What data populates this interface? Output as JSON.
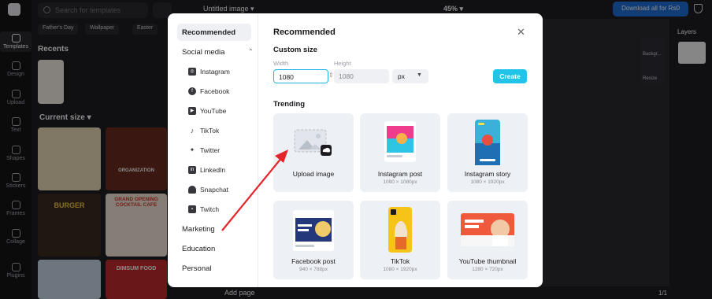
{
  "app": {
    "search_placeholder": "Search for templates",
    "chips": [
      "Father's Day",
      "Wallpaper",
      "Easter"
    ],
    "recents_title": "Recents",
    "current_size_label": "Current size",
    "rail_items": [
      "Templates",
      "Design",
      "Upload",
      "Text",
      "Shapes",
      "Stickers",
      "Frames",
      "Collage",
      "Plugins"
    ],
    "file_title": "Untitled image",
    "zoom": "45%",
    "download_label": "Download all for Rs0",
    "layers_title": "Layers",
    "side_tools": [
      "Backgr...",
      "Resize"
    ],
    "add_page_label": "Add page",
    "page_count": "1/1",
    "template_texts": [
      "GRAND OPENING COCKTAIL CAFE",
      "BURGER",
      "DIMSUM FOOD",
      "ORGANIZATION"
    ]
  },
  "modal": {
    "nav": {
      "recommended": "Recommended",
      "social_media": "Social media",
      "social_items": [
        {
          "label": "Instagram",
          "icon": "instagram-icon"
        },
        {
          "label": "Facebook",
          "icon": "facebook-icon"
        },
        {
          "label": "YouTube",
          "icon": "youtube-icon"
        },
        {
          "label": "TikTok",
          "icon": "tiktok-icon"
        },
        {
          "label": "Twitter",
          "icon": "twitter-icon"
        },
        {
          "label": "LinkedIn",
          "icon": "linkedin-icon"
        },
        {
          "label": "Snapchat",
          "icon": "snapchat-icon"
        },
        {
          "label": "Twitch",
          "icon": "twitch-icon"
        }
      ],
      "marketing": "Marketing",
      "education": "Education",
      "personal": "Personal"
    },
    "title": "Recommended",
    "custom_size_title": "Custom size",
    "width_label": "Width",
    "height_label": "Height",
    "width_value": "1080",
    "height_value": "1080",
    "unit": "px",
    "create_label": "Create",
    "trending_title": "Trending",
    "cards": [
      {
        "label": "Upload image",
        "size": ""
      },
      {
        "label": "Instagram post",
        "size": "1080 × 1080px"
      },
      {
        "label": "Instagram story",
        "size": "1080 × 1920px"
      },
      {
        "label": "Facebook post",
        "size": "940 × 788px"
      },
      {
        "label": "TikTok",
        "size": "1080 × 1920px"
      },
      {
        "label": "YouTube thumbnail",
        "size": "1280 × 720px"
      }
    ]
  },
  "colors": {
    "accent": "#21c3e8",
    "input_focus": "#1fb3e6",
    "annotation_arrow": "#e3262b",
    "download_button": "#1e6fd9"
  }
}
